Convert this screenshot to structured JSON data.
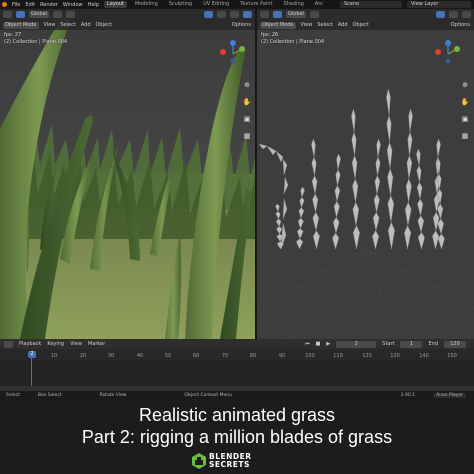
{
  "menubar": {
    "items": [
      "File",
      "Edit",
      "Render",
      "Window",
      "Help"
    ],
    "workspaces": [
      "Layout",
      "Modeling",
      "Sculpting",
      "UV Editing",
      "Texture Paint",
      "Shading",
      "Ani"
    ],
    "active_workspace": "Layout",
    "scene": "Scene",
    "view_layer": "View Layer"
  },
  "left_viewport": {
    "transform_orientation": "Global",
    "mode": "Object Mode",
    "menus": [
      "View",
      "Select",
      "Add",
      "Object"
    ],
    "options": "Options",
    "fps": "fps: 27",
    "collection": "(2) Collection | Plane.004"
  },
  "right_viewport": {
    "transform_orientation": "Global",
    "mode": "Object Mode",
    "menus": [
      "View",
      "Select",
      "Add",
      "Object"
    ],
    "options": "Options",
    "fps": "fps: 26",
    "collection": "(2) Collection | Plane.004"
  },
  "timeline": {
    "menus": [
      "Playback",
      "Keying",
      "View",
      "Marker"
    ],
    "current_frame": "2",
    "start_label": "Start",
    "start": "1",
    "end_label": "End",
    "end": "120",
    "ticks": [
      "2",
      "10",
      "20",
      "30",
      "40",
      "50",
      "60",
      "70",
      "80",
      "90",
      "100",
      "110",
      "120",
      "130",
      "140",
      "150"
    ]
  },
  "statusbar": {
    "select": "Select",
    "box_select": "Box Select",
    "rotate_view": "Rotate View",
    "context_menu": "Object Context Menu",
    "version": "2.90.1",
    "addon": "Anon Player"
  },
  "caption": {
    "line1": "Realistic animated grass",
    "line2": "Part 2: rigging a million blades of grass"
  },
  "brand": {
    "line1": "BLENDER",
    "line2": "SECRETS"
  },
  "colors": {
    "accent": "#4772b3",
    "blender_orange": "#e87d0d",
    "brand_green": "#6abf3a"
  },
  "icons": [
    "blender-logo-icon",
    "play-icon",
    "rewind-icon",
    "stop-icon",
    "navigation-gizmo-icon",
    "zoom-icon",
    "pan-icon",
    "camera-icon",
    "grid-icon"
  ]
}
